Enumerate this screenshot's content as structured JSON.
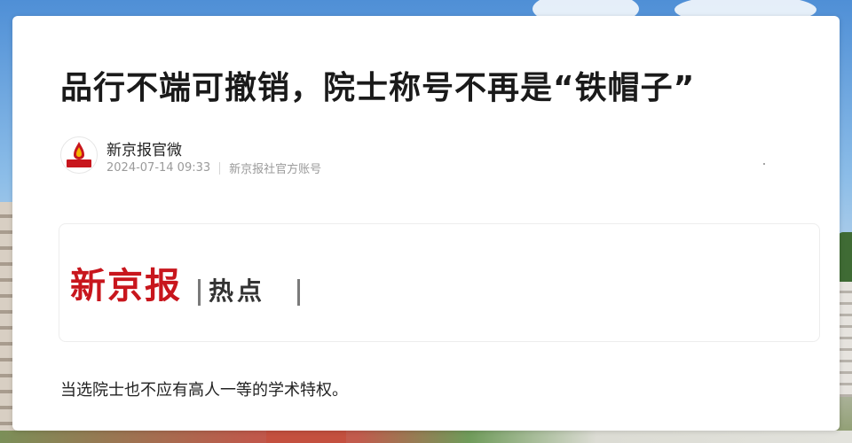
{
  "article": {
    "headline": "品行不端可撤销，院士称号不再是“铁帽子”",
    "author": {
      "name": "新京报官微",
      "avatar_icon": "xinjingbao-logo-icon",
      "avatar_text": "新京报",
      "timestamp": "2024-07-14 09:33",
      "account_type": "新京报社官方账号"
    },
    "banner": {
      "brand_logo": "新京报",
      "section": "热点",
      "brand_color": "#c8161d"
    },
    "body_text": "当选院士也不应有高人一等的学术特权。"
  }
}
